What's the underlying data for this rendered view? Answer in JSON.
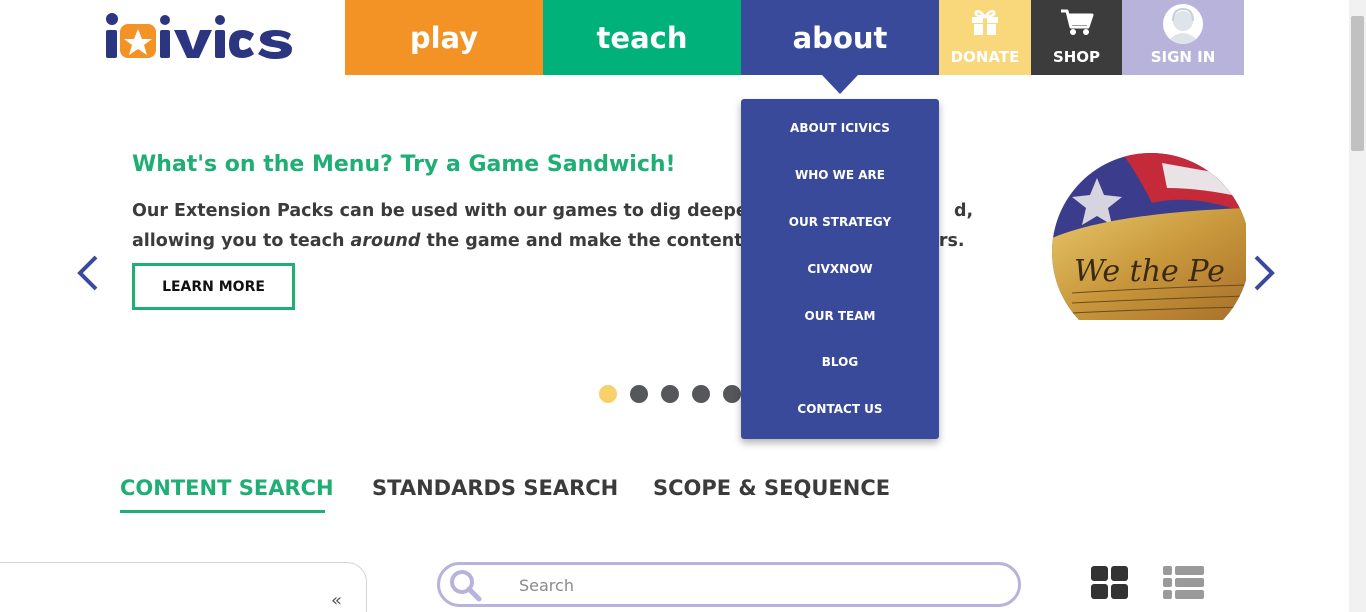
{
  "logo": {
    "text": "iCivics"
  },
  "nav": {
    "play": "play",
    "teach": "teach",
    "about": "about",
    "donate": "DONATE",
    "shop": "SHOP",
    "sign_in": "SIGN IN"
  },
  "about_menu": {
    "items": [
      "ABOUT ICIVICS",
      "WHO WE ARE",
      "OUR STRATEGY",
      "CIVXNOW",
      "OUR TEAM",
      "BLOG",
      "CONTACT US"
    ]
  },
  "hero": {
    "title": "What's on the Menu? Try a Game Sandwich!",
    "line1_visible": "Our Extension Packs can be used with our games to dig deeper into",
    "line1_tail": "d,",
    "line2_pre": "allowing you to teach ",
    "line2_em": "around",
    "line2_post": " the game and make the content more",
    "line2_tail": "ers.",
    "learn_more": "LEARN MORE",
    "image_alt": "We the People"
  },
  "carousel": {
    "slide_count": 5,
    "active_index": 0
  },
  "tabs": [
    "CONTENT SEARCH",
    "STANDARDS SEARCH",
    "SCOPE & SEQUENCE"
  ],
  "search": {
    "placeholder": "Search",
    "value": ""
  },
  "colors": {
    "play": "#f39325",
    "teach": "#00b27a",
    "about": "#3a4a9a",
    "donate": "#f9d77b",
    "shop": "#3c3c3c",
    "signin": "#b8b3db",
    "accent_green": "#1fae74",
    "dot_active": "#f9d06c",
    "dot_inactive": "#55575b"
  },
  "icons": {
    "donate": "gift-icon",
    "shop": "cart-icon",
    "sign_in": "avatar-icon",
    "prev": "chevron-left-icon",
    "next": "chevron-right-icon",
    "collapse": "double-chevron-left-icon",
    "search": "search-icon",
    "grid_view": "grid-view-icon",
    "list_view": "list-view-icon"
  }
}
